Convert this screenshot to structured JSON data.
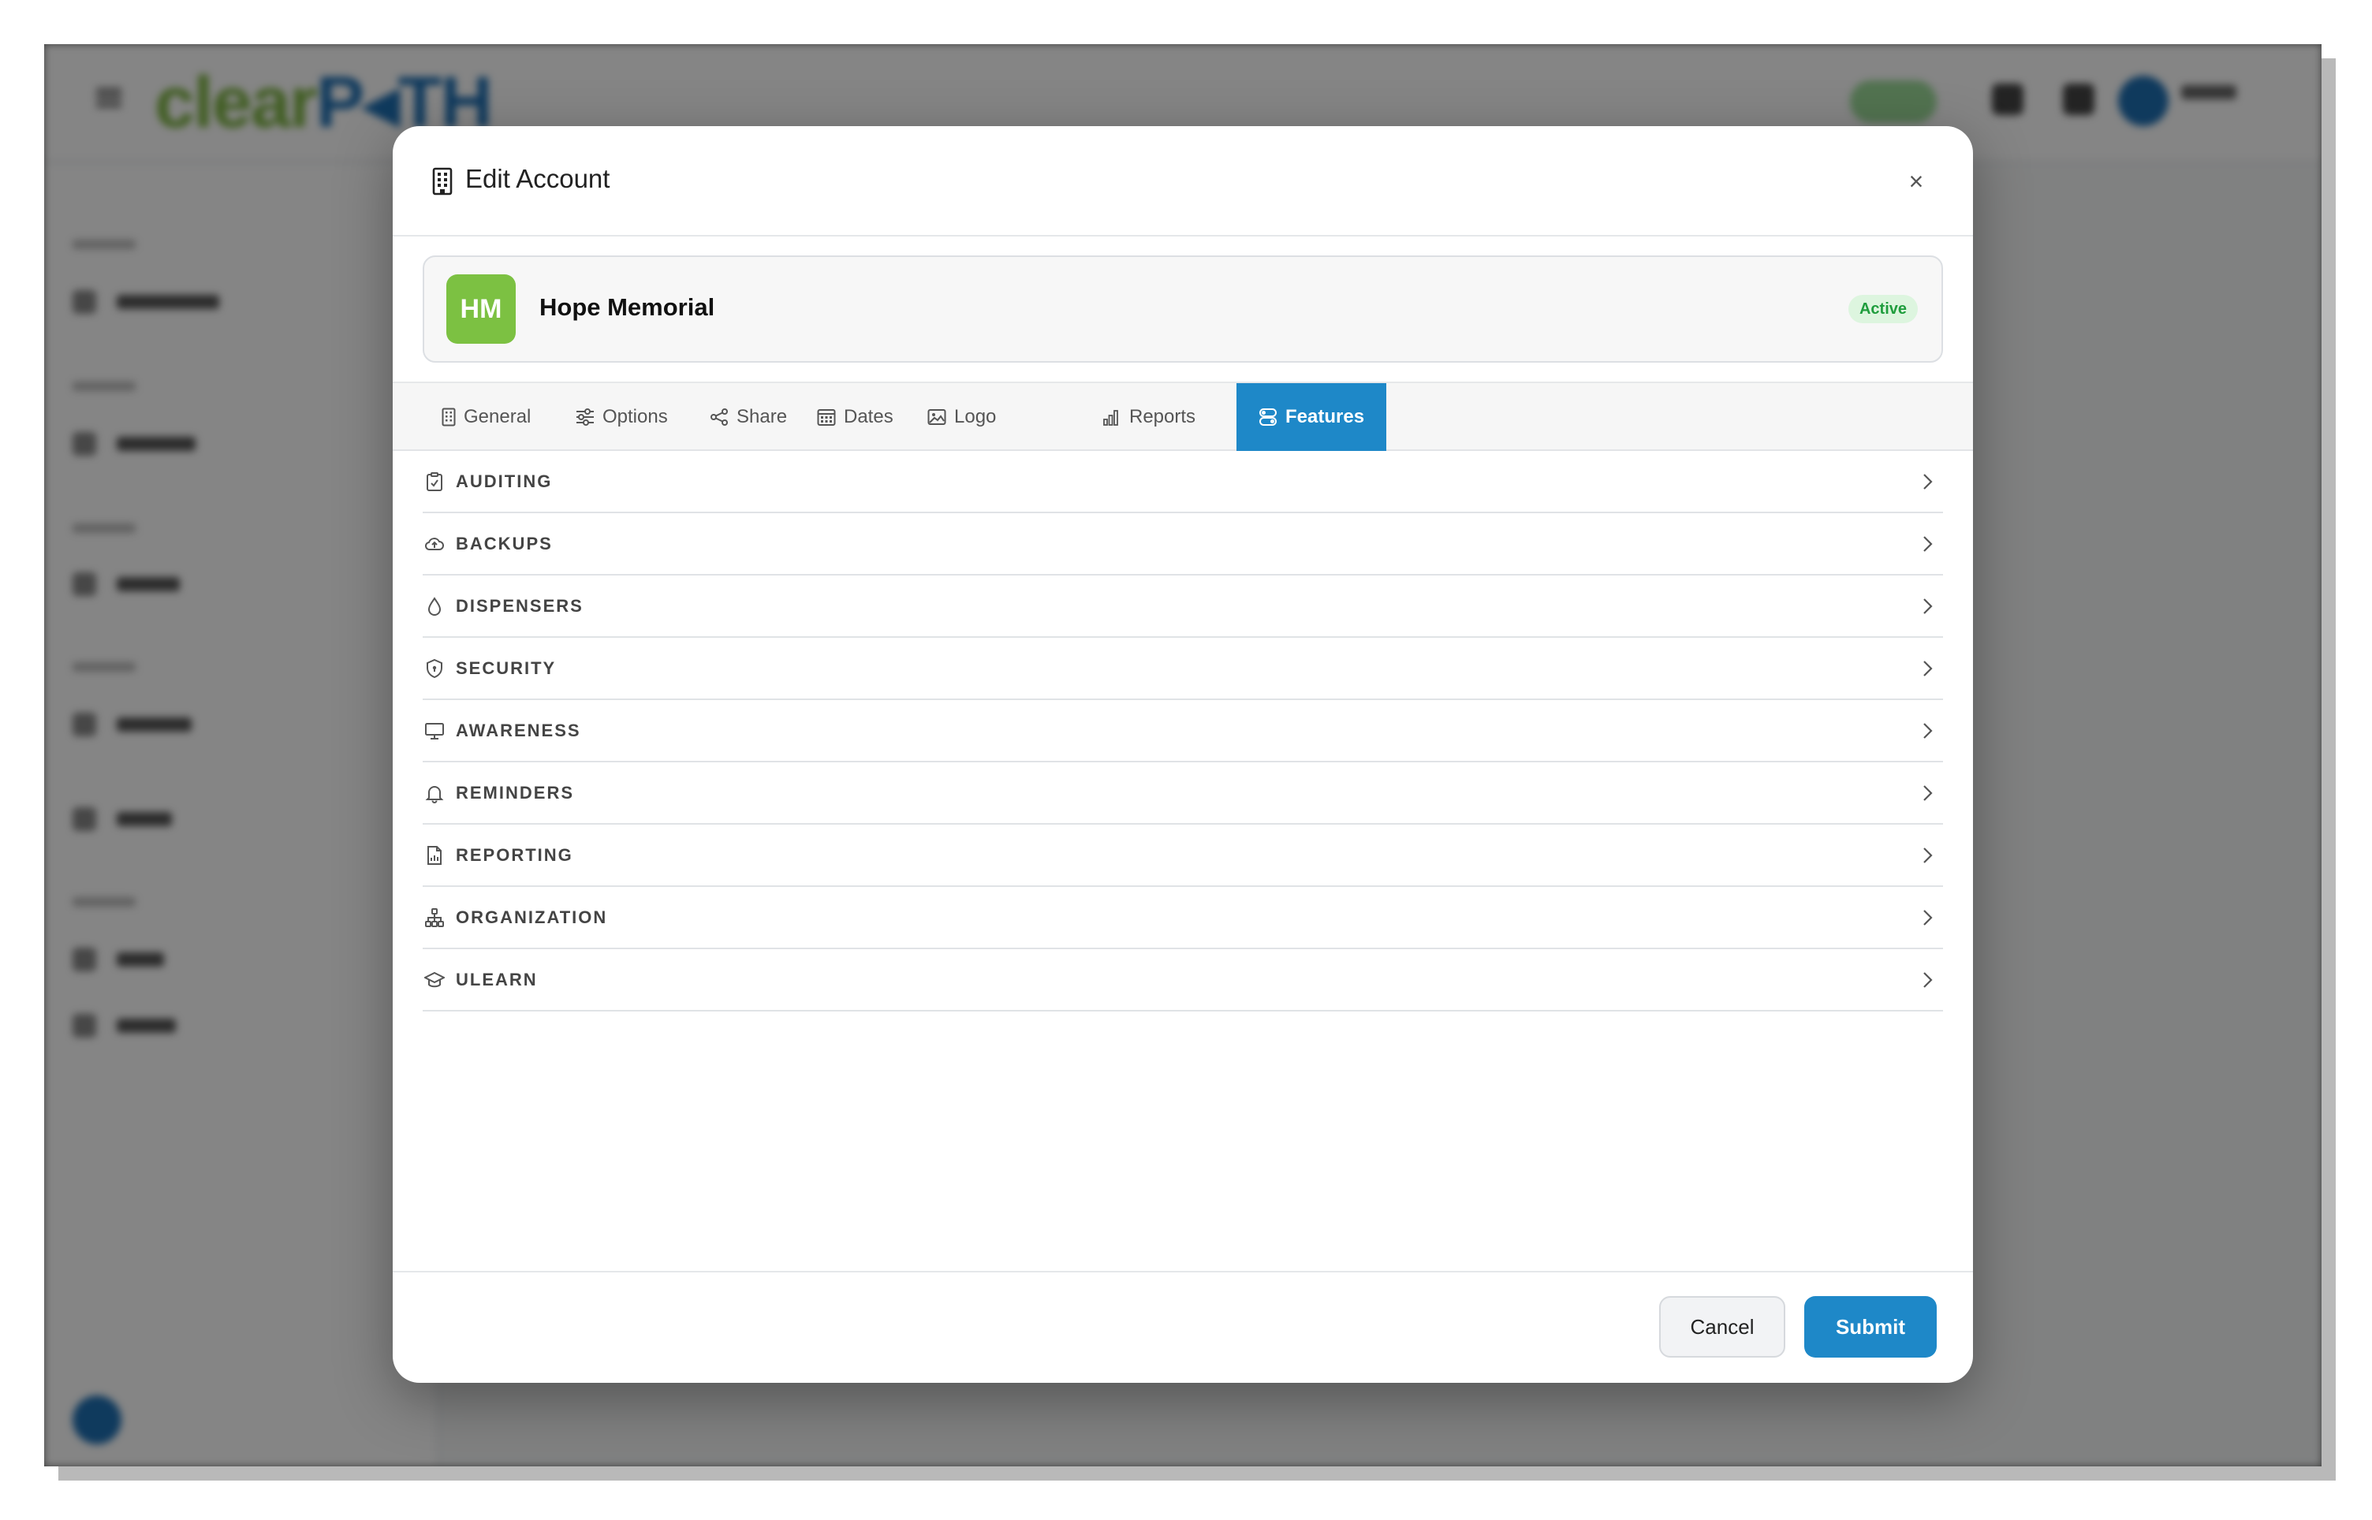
{
  "background_app": {
    "brand": {
      "part1": "clear",
      "part2": "P◂TH"
    }
  },
  "modal": {
    "title": "Edit Account",
    "close_label": "×",
    "account": {
      "initials": "HM",
      "name": "Hope Memorial",
      "status": "Active",
      "avatar_color": "#7cc142"
    },
    "tabs": [
      {
        "label": "General",
        "icon": "building-icon",
        "active": false
      },
      {
        "label": "Options",
        "icon": "sliders-icon",
        "active": false
      },
      {
        "label": "Share",
        "icon": "share-icon",
        "active": false
      },
      {
        "label": "Dates",
        "icon": "calendar-icon",
        "active": false
      },
      {
        "label": "Logo",
        "icon": "image-icon",
        "active": false
      },
      {
        "label": "Reports",
        "icon": "bar-chart-icon",
        "active": false
      },
      {
        "label": "Features",
        "icon": "toggles-icon",
        "active": true
      }
    ],
    "features": [
      {
        "label": "AUDITING",
        "icon": "clipboard-check-icon"
      },
      {
        "label": "BACKUPS",
        "icon": "cloud-upload-icon"
      },
      {
        "label": "DISPENSERS",
        "icon": "droplet-icon"
      },
      {
        "label": "SECURITY",
        "icon": "shield-icon"
      },
      {
        "label": "AWARENESS",
        "icon": "monitor-icon"
      },
      {
        "label": "REMINDERS",
        "icon": "bell-icon"
      },
      {
        "label": "REPORTING",
        "icon": "file-chart-icon"
      },
      {
        "label": "ORGANIZATION",
        "icon": "org-chart-icon"
      },
      {
        "label": "ULEARN",
        "icon": "graduation-cap-icon"
      }
    ],
    "footer": {
      "cancel_label": "Cancel",
      "submit_label": "Submit"
    }
  },
  "colors": {
    "accent": "#1e88c8",
    "status_bg": "#ddf5df",
    "status_text": "#1f9d3d",
    "overlay": "rgba(0,0,0,0.48)"
  }
}
